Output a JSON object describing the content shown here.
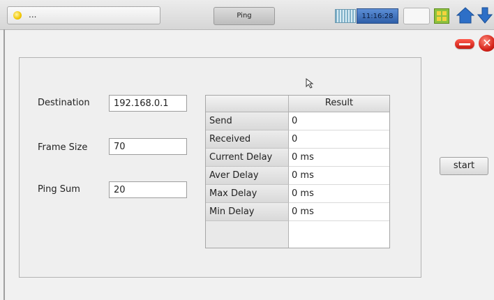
{
  "topbar": {
    "status_text": "...",
    "tab_label": "Ping",
    "clock": "11:16:28",
    "icons": [
      "status-bulb-icon",
      "keyboard-icon",
      "grid-icon",
      "home-icon",
      "arrow-down-icon"
    ]
  },
  "window_controls": {
    "icons": [
      "minimize-icon",
      "close-icon"
    ]
  },
  "form": {
    "destination": {
      "label": "Destination",
      "value": "192.168.0.1"
    },
    "frame_size": {
      "label": "Frame Size",
      "value": "70"
    },
    "ping_sum": {
      "label": "Ping Sum",
      "value": "20"
    }
  },
  "results": {
    "header": "Result",
    "rows": [
      {
        "label": "Send",
        "value": "0"
      },
      {
        "label": "Received",
        "value": "0"
      },
      {
        "label": "Current Delay",
        "value": "0 ms"
      },
      {
        "label": "Aver Delay",
        "value": "0 ms"
      },
      {
        "label": "Max Delay",
        "value": "0 ms"
      },
      {
        "label": "Min Delay",
        "value": "0 ms"
      }
    ]
  },
  "actions": {
    "start_label": "start"
  }
}
